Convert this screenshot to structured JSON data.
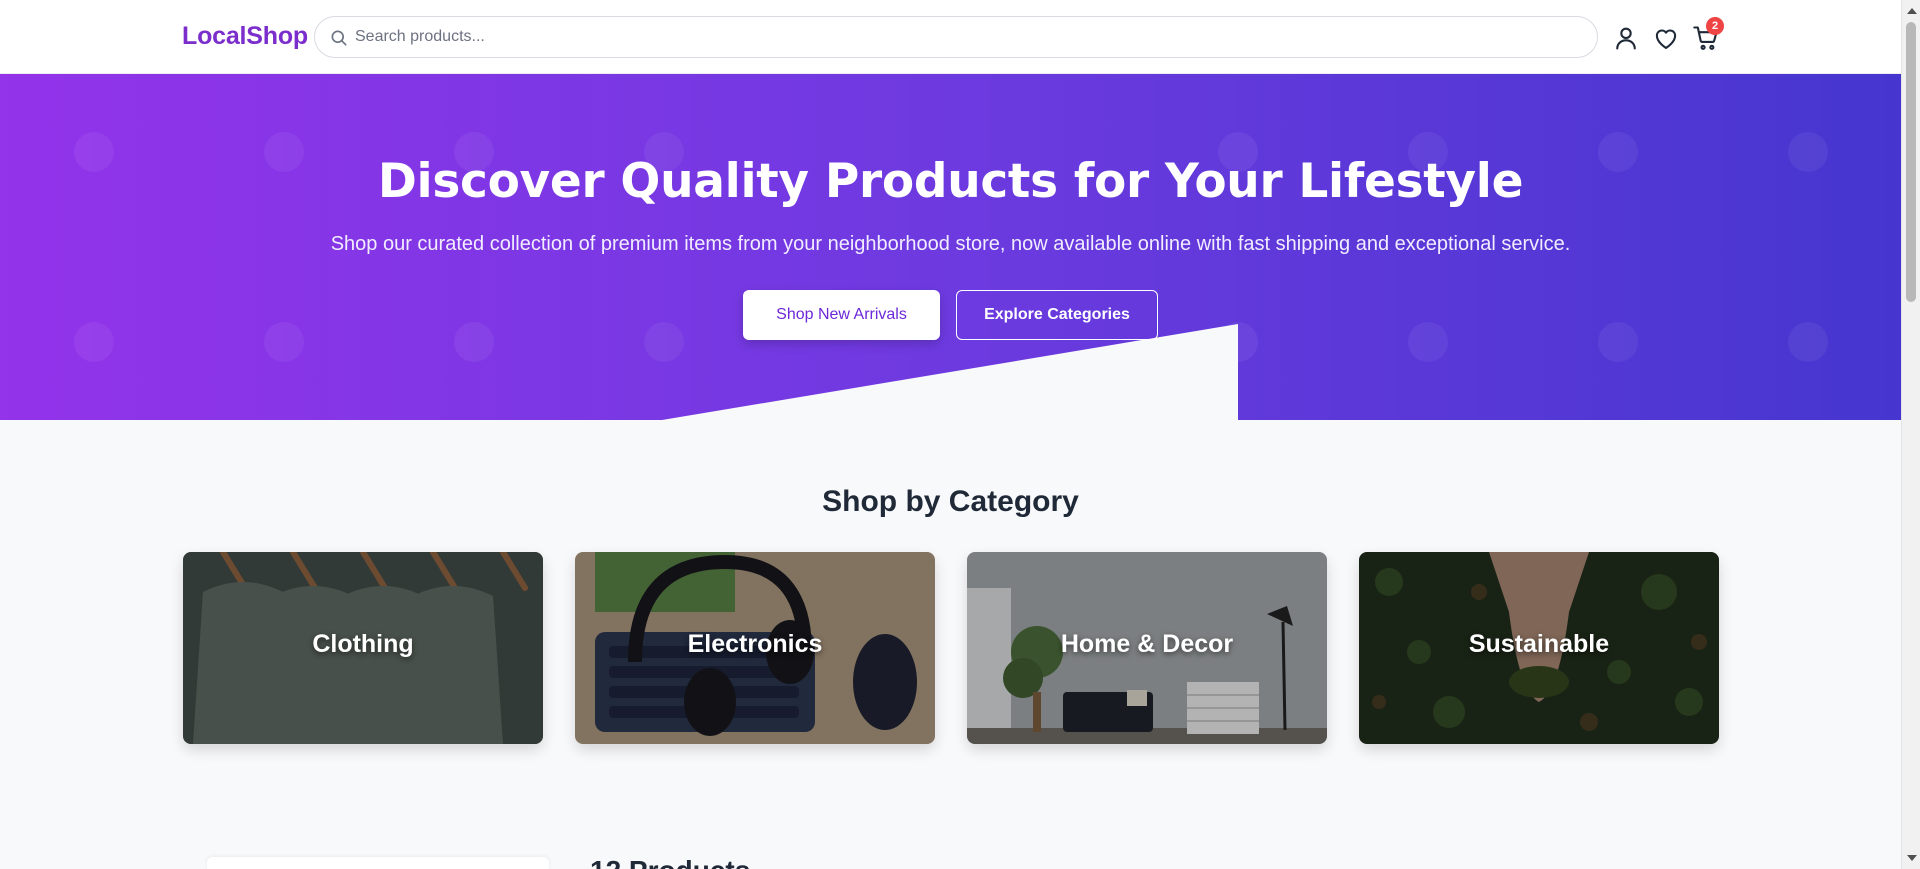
{
  "header": {
    "logo": "LocalShop",
    "search_placeholder": "Search products...",
    "icons": [
      "user-icon",
      "heart-icon",
      "cart-icon"
    ],
    "cart_count": "2"
  },
  "hero": {
    "title": "Discover Quality Products for Your Lifestyle",
    "subtitle": "Shop our curated collection of premium items from your neighborhood store, now available online with fast shipping and exceptional service.",
    "primary_button": "Shop New Arrivals",
    "secondary_button": "Explore Categories",
    "gradient": [
      "#9333ea",
      "#4636cf"
    ]
  },
  "categories": {
    "heading": "Shop by Category",
    "items": [
      {
        "label": "Clothing"
      },
      {
        "label": "Electronics"
      },
      {
        "label": "Home & Decor"
      },
      {
        "label": "Sustainable"
      }
    ]
  },
  "products": {
    "count_label": "12 Products"
  },
  "colors": {
    "brand": "#7b2ecb",
    "badge": "#ef4444",
    "page_bg": "#f8f9fb"
  }
}
